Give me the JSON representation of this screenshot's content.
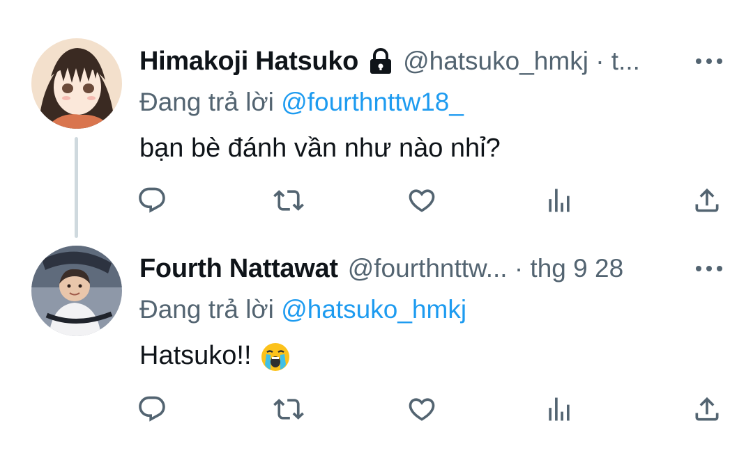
{
  "tweets": [
    {
      "display_name": "Himakoji Hatsuko",
      "protected": true,
      "handle_meta": "@hatsuko_hmkj · t...",
      "replying_prefix": "Đang trả lời",
      "replying_to": "@fourthnttw18_",
      "text": "bạn bè đánh vần như nào nhỉ?",
      "avatar": "anime-girl-avatar"
    },
    {
      "display_name": "Fourth Nattawat",
      "protected": false,
      "handle_meta": "@fourthnttw... · thg 9 28",
      "replying_prefix": "Đang trả lời",
      "replying_to": "@hatsuko_hmkj",
      "text": "Hatsuko!!",
      "emoji": "loudly-crying-face",
      "avatar": "baby-photo-avatar"
    }
  ],
  "actions": [
    "reply-icon",
    "retweet-icon",
    "like-icon",
    "analytics-icon",
    "share-icon"
  ],
  "colors": {
    "text": "#0f1419",
    "secondary": "#536471",
    "mention": "#1d9bf0",
    "thread_line": "#cfd9de"
  }
}
